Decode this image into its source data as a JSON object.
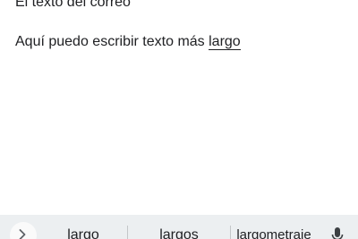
{
  "compose": {
    "line1": "El texto del correo",
    "line2_prefix": "Aquí puedo escribir texto más ",
    "line2_composing": "largo"
  },
  "suggestions": {
    "items": [
      "largo",
      "largos",
      "largometraje"
    ],
    "expand_icon": "chevron-right-icon",
    "mic_icon": "microphone-icon"
  }
}
